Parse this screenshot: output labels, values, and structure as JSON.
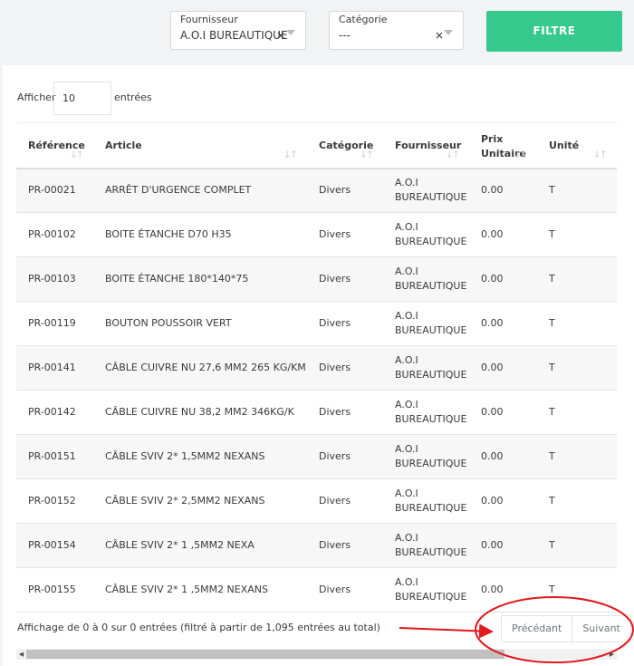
{
  "filters": {
    "supplier": {
      "label": "Fournisseur",
      "value": "A.O.I BUREAUTIQUE",
      "clear": "×"
    },
    "category": {
      "label": "Catégorie",
      "value": "---",
      "clear": "×"
    },
    "filter_button": "FILTRE"
  },
  "length": {
    "prefix": "Afficher",
    "value": "10",
    "suffix": "entrées"
  },
  "table": {
    "headers": {
      "reference": "Référence",
      "article": "Article",
      "category": "Catégorie",
      "supplier": "Fournisseur",
      "price": "Prix Unitaire",
      "unit": "Unité"
    },
    "sort_glyph": "↓↑",
    "rows": [
      {
        "reference": "PR-00021",
        "article": "ARRÊT D'URGENCE COMPLET",
        "category": "Divers",
        "supplier": "A.O.I BUREAUTIQUE",
        "price": "0.00",
        "unit": "T"
      },
      {
        "reference": "PR-00102",
        "article": "BOITE ÉTANCHE D70 H35",
        "category": "Divers",
        "supplier": "A.O.I BUREAUTIQUE",
        "price": "0.00",
        "unit": "T"
      },
      {
        "reference": "PR-00103",
        "article": "BOITE ÉTANCHE 180*140*75",
        "category": "Divers",
        "supplier": "A.O.I BUREAUTIQUE",
        "price": "0.00",
        "unit": "T"
      },
      {
        "reference": "PR-00119",
        "article": "BOUTON POUSSOIR VERT",
        "category": "Divers",
        "supplier": "A.O.I BUREAUTIQUE",
        "price": "0.00",
        "unit": "T"
      },
      {
        "reference": "PR-00141",
        "article": "CÂBLE CUIVRE NU 27,6 MM2 265 KG/KM",
        "category": "Divers",
        "supplier": "A.O.I BUREAUTIQUE",
        "price": "0.00",
        "unit": "T"
      },
      {
        "reference": "PR-00142",
        "article": "CÂBLE CUIVRE NU 38,2 MM2 346KG/K",
        "category": "Divers",
        "supplier": "A.O.I BUREAUTIQUE",
        "price": "0.00",
        "unit": "T"
      },
      {
        "reference": "PR-00151",
        "article": "CÂBLE SVIV 2* 1,5MM2 NEXANS",
        "category": "Divers",
        "supplier": "A.O.I BUREAUTIQUE",
        "price": "0.00",
        "unit": "T"
      },
      {
        "reference": "PR-00152",
        "article": "CÂBLE SVIV 2* 2,5MM2 NEXANS",
        "category": "Divers",
        "supplier": "A.O.I BUREAUTIQUE",
        "price": "0.00",
        "unit": "T"
      },
      {
        "reference": "PR-00154",
        "article": "CÂBLE SVIV 2* 1 ,5MM2 NEXA",
        "category": "Divers",
        "supplier": "A.O.I BUREAUTIQUE",
        "price": "0.00",
        "unit": "T"
      },
      {
        "reference": "PR-00155",
        "article": "CÂBLE SVIV 2* 1 ,5MM2 NEXANS",
        "category": "Divers",
        "supplier": "A.O.I BUREAUTIQUE",
        "price": "0.00",
        "unit": "T"
      }
    ]
  },
  "info": "Affichage de 0 à 0 sur 0 entrées (filtré à partir de 1,095 entrées au total)",
  "pagination": {
    "previous": "Précédant",
    "next": "Suivant"
  },
  "scrollbar": {
    "left_arrow": "◀",
    "right_arrow": "▶"
  },
  "colors": {
    "accent": "#36c98d",
    "annotation": "#e0191f"
  }
}
